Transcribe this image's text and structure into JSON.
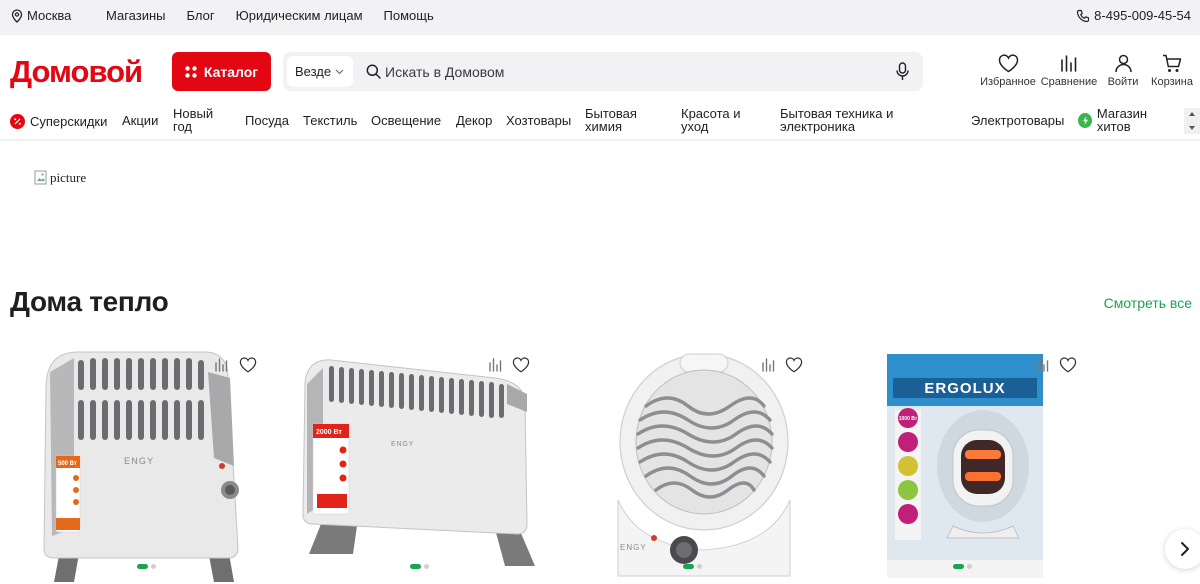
{
  "topbar": {
    "city": "Москва",
    "links": [
      "Магазины",
      "Блог",
      "Юридическим лицам",
      "Помощь"
    ],
    "phone": "8-495-009-45-54"
  },
  "header": {
    "logo_text": "Домовой",
    "catalog_label": "Каталог",
    "search_scope": "Везде",
    "search_placeholder": "Искать в Домовом",
    "icons": [
      {
        "label": "Избранное",
        "icon": "heart-icon"
      },
      {
        "label": "Сравнение",
        "icon": "compare-icon"
      },
      {
        "label": "Войти",
        "icon": "user-icon"
      },
      {
        "label": "Корзина",
        "icon": "cart-icon"
      }
    ]
  },
  "nav": {
    "items": [
      {
        "label": "Суперскидки"
      },
      {
        "label": "Акции"
      },
      {
        "label": "Новый год"
      },
      {
        "label": "Посуда"
      },
      {
        "label": "Текстиль"
      },
      {
        "label": "Освещение"
      },
      {
        "label": "Декор"
      },
      {
        "label": "Хозтовары"
      },
      {
        "label": "Бытовая химия"
      },
      {
        "label": "Красота и уход"
      },
      {
        "label": "Бытовая техника и электроника"
      },
      {
        "label": "Электротовары"
      },
      {
        "label": "Магазин хитов"
      }
    ]
  },
  "banner": {
    "alt": "picture"
  },
  "section": {
    "title": "Дома тепло",
    "see_all": "Смотреть все"
  },
  "products": [
    {
      "name": "ENGY Mini convector heater",
      "badge": "500 Вт",
      "brand": "ENGY"
    },
    {
      "name": "ENGY convector heater",
      "badge": "2000 Вт",
      "brand": "ENGY"
    },
    {
      "name": "ENGY fan heater",
      "brand": "ENGY"
    },
    {
      "name": "ERGOLUX halogen heater",
      "badge": "1000 Вт",
      "brand": "ERGOLUX"
    }
  ],
  "colors": {
    "accent": "#e30613",
    "link_green": "#1aa351",
    "topbar_bg": "#f2f2f5"
  }
}
